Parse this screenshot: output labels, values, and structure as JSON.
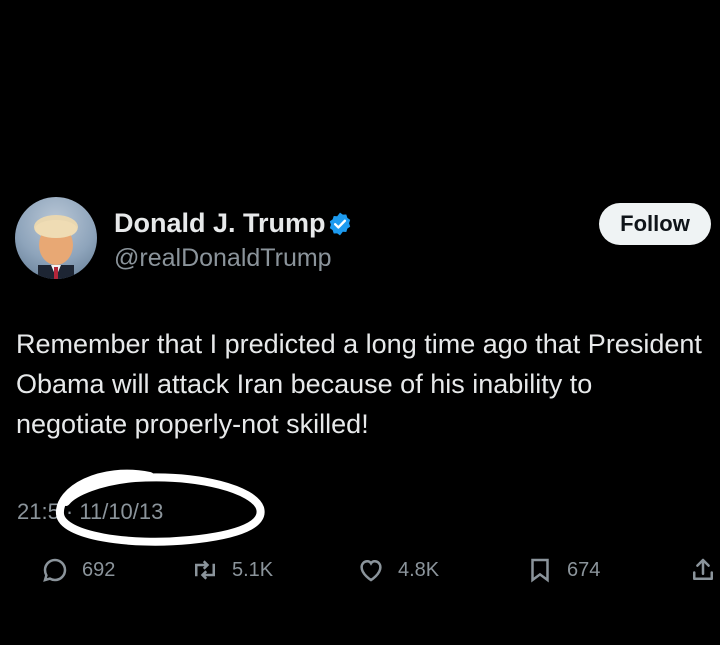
{
  "author": {
    "display_name": "Donald J. Trump",
    "handle": "@realDonaldTrump",
    "verified_color": "#1d9bf0"
  },
  "follow_button": {
    "label": "Follow"
  },
  "tweet": {
    "text": "Remember that I predicted a long time ago that President Obama will attack Iran because of his inability to negotiate properly-not skilled!",
    "timestamp": "21:5 · 11/10/13"
  },
  "actions": {
    "replies": "692",
    "retweets": "5.1K",
    "likes": "4.8K",
    "bookmarks": "674"
  },
  "annotation": {
    "color": "#ffffff",
    "shape": "hand-drawn ellipse around timestamp"
  }
}
